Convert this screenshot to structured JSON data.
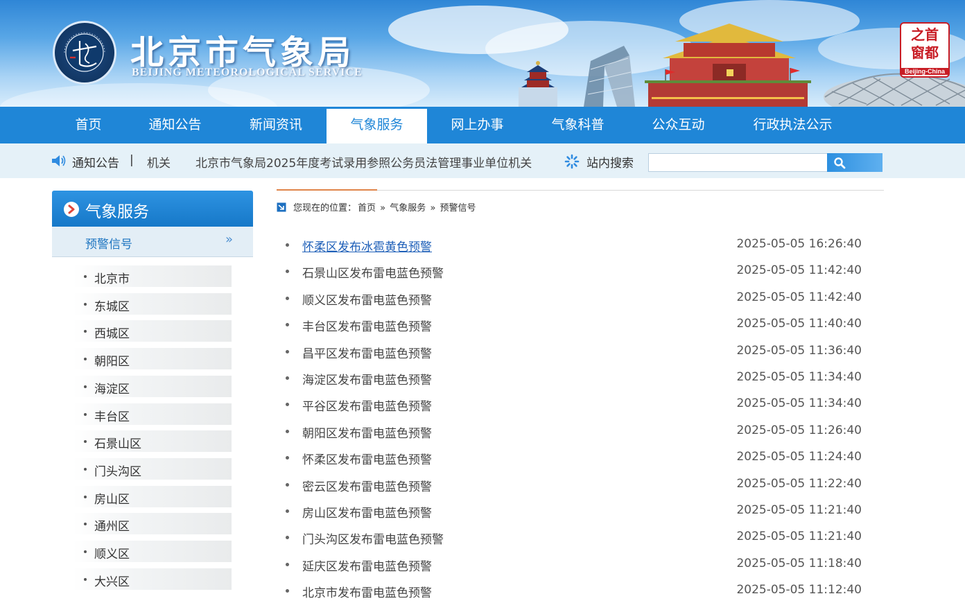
{
  "banner": {
    "title": "北京市气象局",
    "subtitle": "BEIJING METEOROLOGICAL SERVICE",
    "logo_ring_text": "BEIJING METEOROLOGICAL SERVICE",
    "logo_inner_text": "北京市气象局",
    "capital_badge": {
      "chars": "之首 窗都",
      "en": "Beijing-China"
    }
  },
  "nav": {
    "items": [
      "首页",
      "通知公告",
      "新闻资讯",
      "气象服务",
      "网上办事",
      "气象科普",
      "公众互动",
      "行政执法公示"
    ],
    "active_index": 3
  },
  "notice": {
    "label": "通知公告",
    "separator": "|",
    "ticker_items": [
      "机关",
      "北京市气象局2025年度考试录用参照公务员法管理事业单位机关"
    ],
    "search_label": "站内搜索",
    "search_value": "",
    "search_icon": "magnifier-icon",
    "speaker_icon": "speaker-icon"
  },
  "sidebar": {
    "title": "气象服务",
    "sub_title": "预警信号",
    "sub_chevron": "»",
    "districts": [
      "北京市",
      "东城区",
      "西城区",
      "朝阳区",
      "海淀区",
      "丰台区",
      "石景山区",
      "门头沟区",
      "房山区",
      "通州区",
      "顺义区",
      "大兴区"
    ]
  },
  "breadcrumb": {
    "prefix": "您现在的位置：",
    "items": [
      "首页",
      "气象服务",
      "预警信号"
    ],
    "separator": "»"
  },
  "warnings": [
    {
      "title": "怀柔区发布冰雹黄色预警",
      "date": "2025-05-05 16:26:40"
    },
    {
      "title": "石景山区发布雷电蓝色预警",
      "date": "2025-05-05 11:42:40"
    },
    {
      "title": "顺义区发布雷电蓝色预警",
      "date": "2025-05-05 11:42:40"
    },
    {
      "title": "丰台区发布雷电蓝色预警",
      "date": "2025-05-05 11:40:40"
    },
    {
      "title": "昌平区发布雷电蓝色预警",
      "date": "2025-05-05 11:36:40"
    },
    {
      "title": "海淀区发布雷电蓝色预警",
      "date": "2025-05-05 11:34:40"
    },
    {
      "title": "平谷区发布雷电蓝色预警",
      "date": "2025-05-05 11:34:40"
    },
    {
      "title": "朝阳区发布雷电蓝色预警",
      "date": "2025-05-05 11:26:40"
    },
    {
      "title": "怀柔区发布雷电蓝色预警",
      "date": "2025-05-05 11:24:40"
    },
    {
      "title": "密云区发布雷电蓝色预警",
      "date": "2025-05-05 11:22:40"
    },
    {
      "title": "房山区发布雷电蓝色预警",
      "date": "2025-05-05 11:21:40"
    },
    {
      "title": "门头沟区发布雷电蓝色预警",
      "date": "2025-05-05 11:21:40"
    },
    {
      "title": "延庆区发布雷电蓝色预警",
      "date": "2025-05-05 11:18:40"
    },
    {
      "title": "北京市发布雷电蓝色预警",
      "date": "2025-05-05 11:12:40"
    }
  ],
  "colors": {
    "nav_blue": "#1f86d7",
    "link_blue": "#1e5fb8",
    "accent_orange": "#e0844a"
  }
}
